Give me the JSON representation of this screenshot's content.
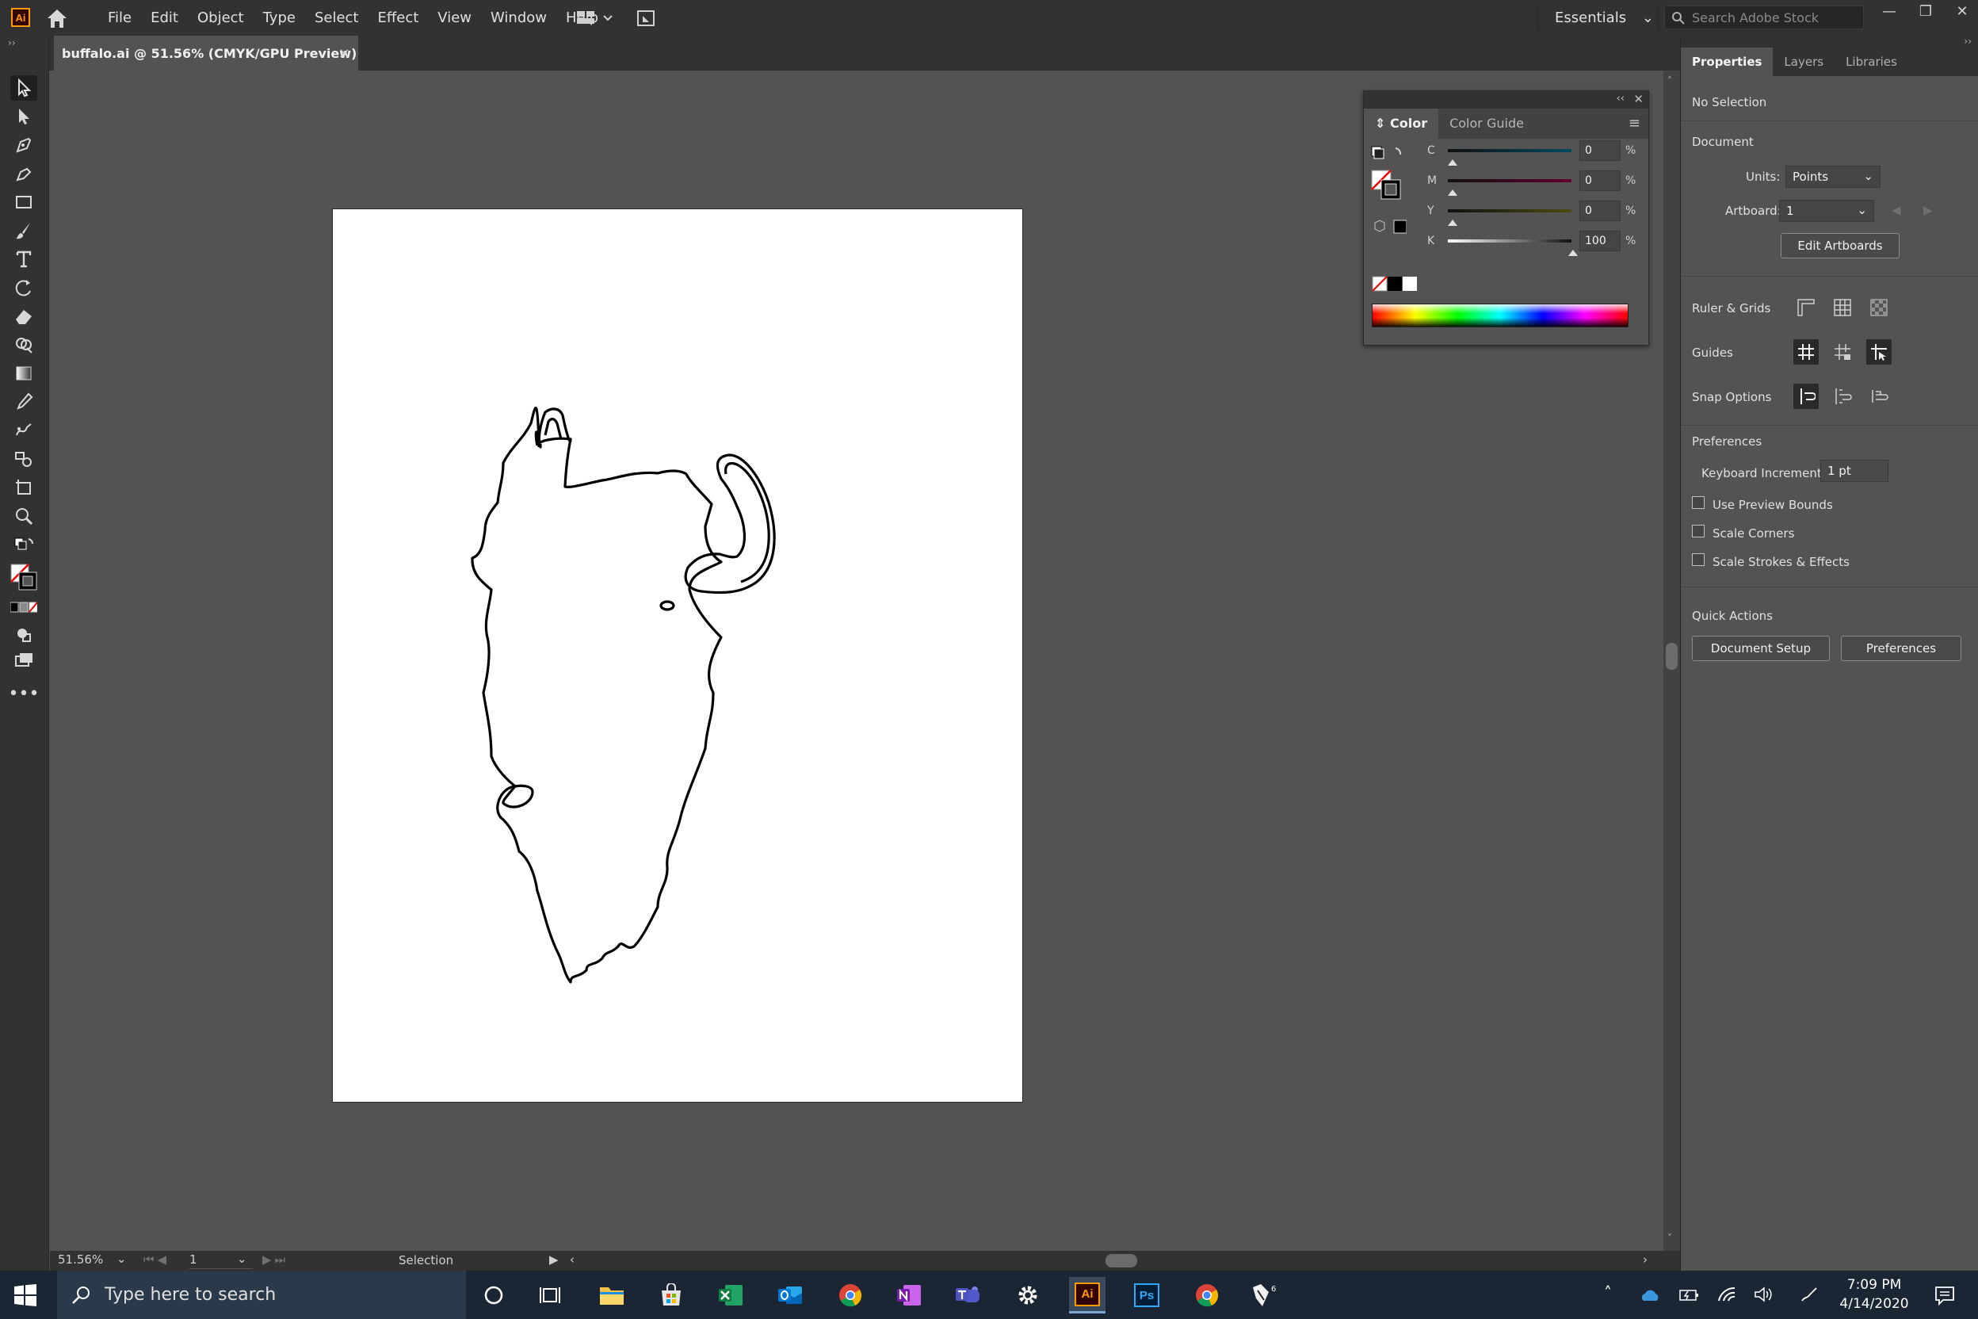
{
  "app": {
    "logo_text": "Ai"
  },
  "menu": [
    "File",
    "Edit",
    "Object",
    "Type",
    "Select",
    "Effect",
    "View",
    "Window",
    "Help"
  ],
  "workspace": "Essentials",
  "search_stock_placeholder": "Search Adobe Stock",
  "window_controls": {
    "minimize": "—",
    "restore": "❐",
    "close": "✕"
  },
  "document": {
    "tab_title": "buffalo.ai @ 51.56% (CMYK/GPU Preview)",
    "close": "×"
  },
  "status": {
    "zoom": "51.56%",
    "artboard_number": "1",
    "current_tool": "Selection"
  },
  "color_panel": {
    "tabs": [
      "Color",
      "Color Guide"
    ],
    "channels": [
      {
        "name": "C",
        "value": "0",
        "unit": "%",
        "color": "#00a8e0"
      },
      {
        "name": "M",
        "value": "0",
        "unit": "%",
        "color": "#e0007a"
      },
      {
        "name": "Y",
        "value": "0",
        "unit": "%",
        "color": "#e8e000"
      },
      {
        "name": "K",
        "value": "100",
        "unit": "%",
        "color": "#000000"
      }
    ]
  },
  "properties": {
    "tabs": [
      "Properties",
      "Layers",
      "Libraries"
    ],
    "selection": "No Selection",
    "document_heading": "Document",
    "units_label": "Units:",
    "units_value": "Points",
    "artboard_label": "Artboard:",
    "artboard_value": "1",
    "edit_artboards": "Edit Artboards",
    "ruler_grids": "Ruler & Grids",
    "guides": "Guides",
    "snap_options": "Snap Options",
    "preferences_heading": "Preferences",
    "keyboard_increment_label": "Keyboard Increment:",
    "keyboard_increment_value": "1 pt",
    "checkboxes": [
      "Use Preview Bounds",
      "Scale Corners",
      "Scale Strokes & Effects"
    ],
    "quick_actions": "Quick Actions",
    "document_setup": "Document Setup",
    "preferences_button": "Preferences"
  },
  "taskbar": {
    "search_placeholder": "Type here to search",
    "apps": [
      "task-view",
      "file-explorer",
      "store",
      "excel",
      "outlook",
      "chrome",
      "onenote",
      "teams",
      "settings",
      "illustrator",
      "photoshop",
      "chrome-profile",
      "inkscape-like"
    ],
    "time": "7:09 PM",
    "date": "4/14/2020"
  },
  "colors": {
    "accent_ai": "#ff9a00",
    "chrome_dark": "#323232",
    "canvas": "#535353"
  }
}
